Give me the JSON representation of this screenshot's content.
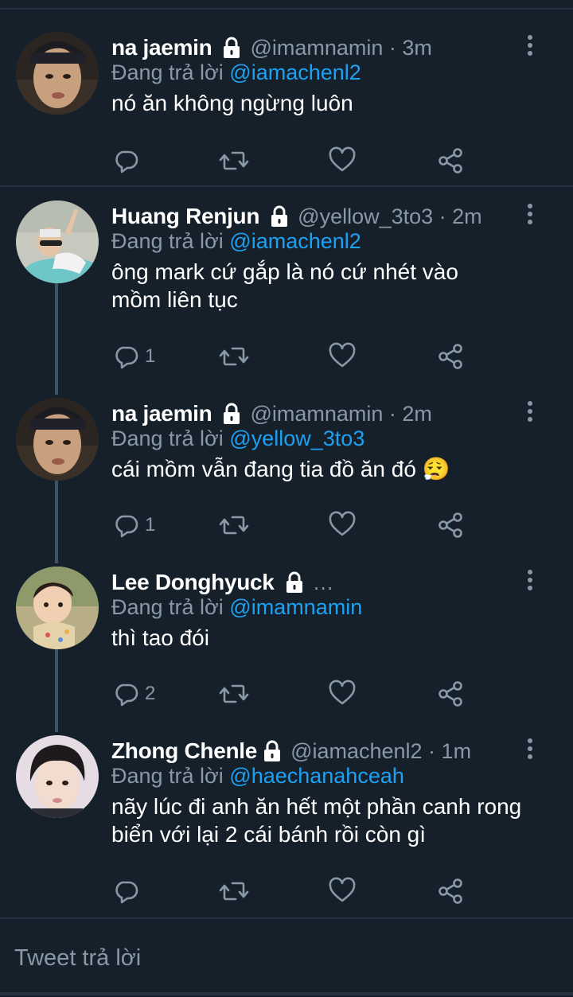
{
  "tweets": [
    {
      "name": "na jaemin",
      "handle": "@imamnamin · 3m",
      "replying_prefix": "Đang trả lời",
      "replying_to": "@iamachenl2",
      "text": "nó ăn không ngừng luôn",
      "reply_count": ""
    },
    {
      "name": "Huang Renjun",
      "handle": "@yellow_3to3 · 2m",
      "replying_prefix": "Đang trả lời",
      "replying_to": "@iamachenl2",
      "text": "ông mark cứ gắp là nó cứ nhét vào mồm liên tục",
      "reply_count": "1"
    },
    {
      "name": "na jaemin",
      "handle": "@imamnamin · 2m",
      "replying_prefix": "Đang trả lời",
      "replying_to": "@yellow_3to3",
      "text": "cái mồm vẫn đang tia đồ ăn đó 😮‍💨",
      "reply_count": "1"
    },
    {
      "name": "Lee Donghyuck",
      "handle": "…",
      "replying_prefix": "Đang trả lời",
      "replying_to": "@imamnamin",
      "text": "thì tao đói",
      "reply_count": "2"
    },
    {
      "name": "Zhong Chenle",
      "handle": "@iamachenl2 · 1m",
      "replying_prefix": "Đang trả lời",
      "replying_to": "@haechanahceah",
      "text": "nãy lúc đi anh ăn hết một phần canh rong biển với lại 2 cái bánh rồi còn gì",
      "reply_count": ""
    }
  ],
  "composer": {
    "placeholder": "Tweet trả lời"
  },
  "colors": {
    "background": "#15202b",
    "secondary_text": "#8899a6",
    "mention": "#1da1f2",
    "divider": "#253341"
  },
  "icons": [
    "lock-icon",
    "more-vertical-icon",
    "reply-icon",
    "retweet-icon",
    "like-icon",
    "share-icon"
  ]
}
